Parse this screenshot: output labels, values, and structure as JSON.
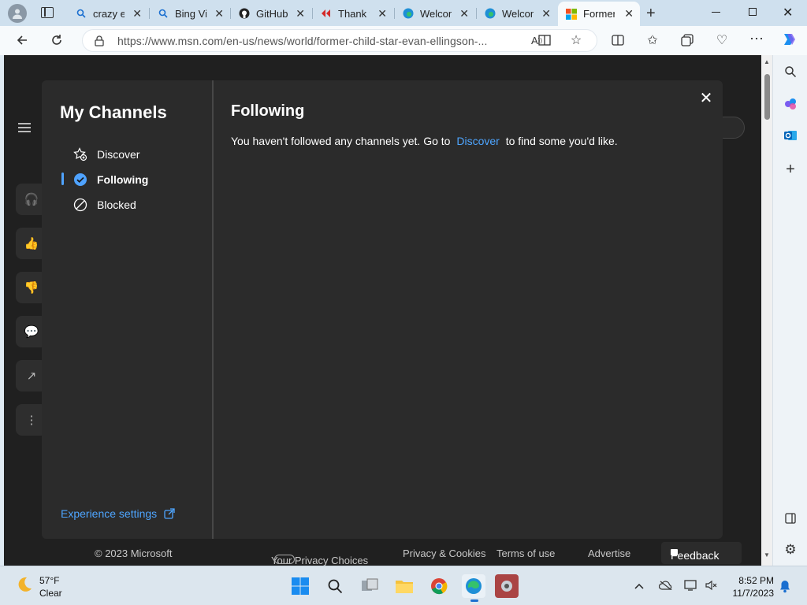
{
  "tabs": [
    {
      "label": "crazy e",
      "icon": "search-icon"
    },
    {
      "label": "Bing Vi",
      "icon": "search-icon"
    },
    {
      "label": "GitHub",
      "icon": "github-icon"
    },
    {
      "label": "Thank y",
      "icon": "message-icon"
    },
    {
      "label": "Welcom",
      "icon": "edge-icon"
    },
    {
      "label": "Welcom",
      "icon": "edge-icon"
    },
    {
      "label": "Former",
      "icon": "microsoft-icon"
    }
  ],
  "address_bar": {
    "url": "https://www.msn.com/en-us/news/world/former-child-star-evan-ellingson-..."
  },
  "modal": {
    "title": "My Channels",
    "nav": [
      {
        "label": "Discover",
        "icon": "discover-star-icon"
      },
      {
        "label": "Following",
        "icon": "check-circle-icon"
      },
      {
        "label": "Blocked",
        "icon": "blocked-icon"
      }
    ],
    "active_nav": "Following",
    "experience_settings": "Experience settings",
    "content_title": "Following",
    "content_message_prefix": "You haven't followed any channels yet. Go to",
    "content_message_link": "Discover",
    "content_message_suffix": "to find some you'd like."
  },
  "footer": {
    "copyright": "© 2023 Microsoft",
    "privacy_choices": "Your Privacy Choices",
    "privacy_cookies": "Privacy & Cookies",
    "terms": "Terms of use",
    "advertise": "Advertise",
    "feedback": "Feedback"
  },
  "taskbar": {
    "weather_temp": "57°F",
    "weather_condition": "Clear",
    "time": "8:52 PM",
    "date": "11/7/2023"
  },
  "colors": {
    "link": "#4ea5ff",
    "modal_bg": "#2b2b2b",
    "page_bg": "#202020"
  }
}
